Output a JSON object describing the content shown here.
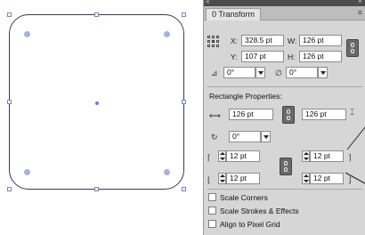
{
  "panel": {
    "tab_label": "Transform",
    "tab_prefix": "0",
    "x_label": "X:",
    "x_value": "328.5 pt",
    "y_label": "Y:",
    "y_value": "107 pt",
    "w_label": "W:",
    "w_value": "126 pt",
    "h_label": "H:",
    "h_value": "126 pt",
    "angle_value": "0°",
    "shear_value": "0°"
  },
  "rectangle": {
    "section_title": "Rectangle Properties:",
    "width_value": "126 pt",
    "height_value": "126 pt",
    "rotation_value": "0°",
    "corner_tl": "12 pt",
    "corner_tr": "12 pt",
    "corner_bl": "12 pt",
    "corner_br": "12 pt"
  },
  "options": [
    {
      "label": "Scale Corners",
      "checked": false
    },
    {
      "label": "Scale Strokes & Effects",
      "checked": false
    },
    {
      "label": "Align to Pixel Grid",
      "checked": false
    }
  ],
  "colors": {
    "shape_stroke": "#3a3a52",
    "handle_border": "#7b84c8",
    "panel_bg": "#d6d6d6",
    "panel_header": "#4c4c4c"
  }
}
